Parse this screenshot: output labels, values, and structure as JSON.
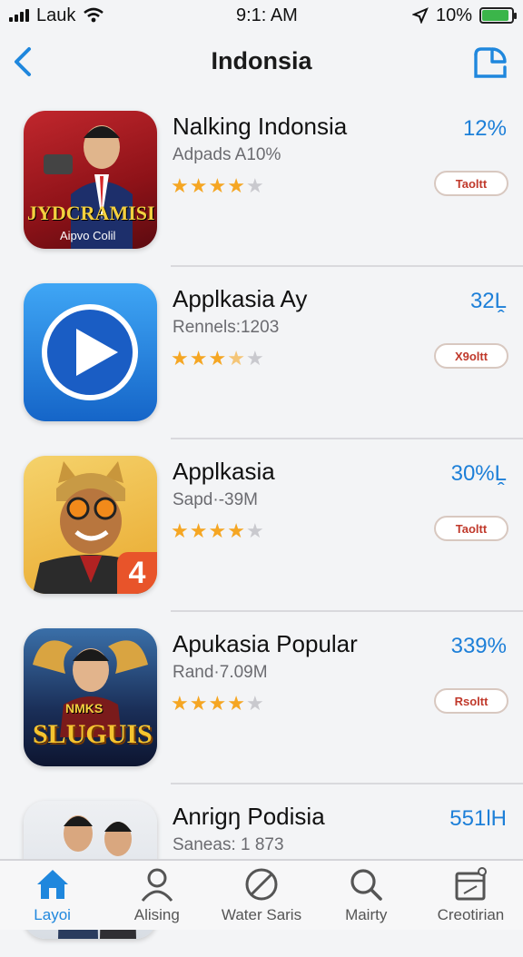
{
  "status_bar": {
    "carrier": "Lauk",
    "time": "9:1: AM",
    "battery": "10%",
    "battery_level": 0.9
  },
  "nav": {
    "title": "Indonsia"
  },
  "apps": [
    {
      "name": "Nalking Indonsia",
      "subtitle": "Adpads A10%",
      "percent": "12%",
      "button": "Taoltt",
      "rating": 4,
      "icon_text": "JYDCRAMISI",
      "icon_caption": "Aipvo Colil",
      "icon_badge": ""
    },
    {
      "name": "Applkasia Ay",
      "subtitle": "Rennels:1203",
      "percent": "32Ḽ",
      "button": "X9oltt",
      "rating": 3.5,
      "icon_text": "",
      "icon_caption": "",
      "icon_badge": ""
    },
    {
      "name": "Applkasia",
      "subtitle": "Sapd·-39M",
      "percent": "30%Ḽ",
      "button": "Taoltt",
      "rating": 4,
      "icon_text": "",
      "icon_caption": "",
      "icon_badge": "4"
    },
    {
      "name": "Apukasia Popular",
      "subtitle": "Rand·7.09M",
      "percent": "339%",
      "button": "Rsoltt",
      "rating": 4,
      "icon_text": "SLUGUIS",
      "icon_caption": "NMKS",
      "icon_badge": ""
    },
    {
      "name": "Anrigŋ Podisia",
      "subtitle": "Saneas: 1 873",
      "percent": "551lH",
      "button": "",
      "rating": 0,
      "icon_text": "",
      "icon_caption": "",
      "icon_badge": ""
    }
  ],
  "tabs": [
    {
      "label": "Layoi",
      "icon": "home-icon",
      "active": true
    },
    {
      "label": "Alising",
      "icon": "person-icon",
      "active": false
    },
    {
      "label": "Water Saris",
      "icon": "circle-slash-icon",
      "active": false
    },
    {
      "label": "Mairty",
      "icon": "search-icon",
      "active": false
    },
    {
      "label": "Creotirian",
      "icon": "calendar-icon",
      "active": false
    }
  ],
  "colors": {
    "accent": "#1f87dd",
    "star": "#f5a623",
    "button_text": "#c0392b"
  }
}
